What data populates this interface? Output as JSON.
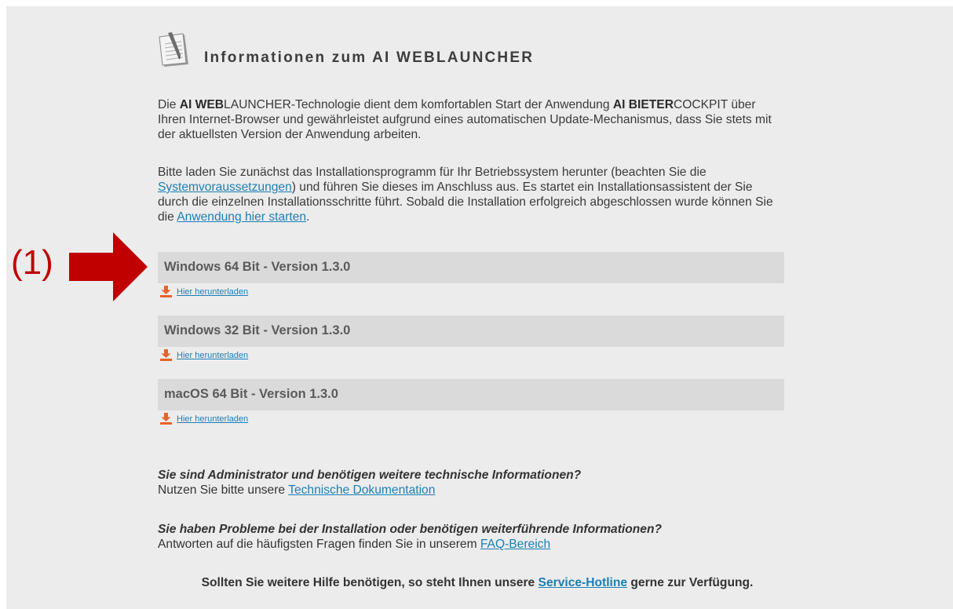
{
  "header": {
    "title": "Informationen zum AI WEBLAUNCHER",
    "icon": "notepad-icon"
  },
  "intro": {
    "p1_b1": "AI WEB",
    "p1_t1": "Die ",
    "p1_t2": "LAUNCHER-Technologie dient dem komfortablen Start der Anwendung ",
    "p1_b2": "AI BIETER",
    "p1_t3": "COCKPIT über Ihren Internet-Browser und gewährleistet aufgrund eines automatischen Update-Mechanismus, dass Sie stets mit der aktuellsten Version der Anwendung arbeiten.",
    "p2_t1": "Bitte laden Sie zunächst das Installationsprogramm für Ihr Betriebssystem herunter (beachten Sie die ",
    "p2_link1": "Systemvoraussetzungen",
    "p2_t2": ") und führen Sie dieses im Anschluss aus. Es startet ein Installationsassistent der Sie durch die einzelnen Installationsschritte führt. Sobald die Installation erfolgreich abgeschlossen wurde können Sie die ",
    "p2_link2": "Anwendung hier starten",
    "p2_t3": "."
  },
  "downloads": [
    {
      "title": "Windows 64 Bit - Version 1.3.0",
      "link": "Hier herunterladen"
    },
    {
      "title": "Windows 32 Bit - Version 1.3.0",
      "link": "Hier herunterladen"
    },
    {
      "title": "macOS 64 Bit - Version 1.3.0",
      "link": "Hier herunterladen"
    }
  ],
  "admin": {
    "question": "Sie sind Administrator und benötigen weitere technische Informationen?",
    "text": "Nutzen Sie bitte unsere ",
    "link": "Technische Dokumentation"
  },
  "faq": {
    "question": "Sie haben Probleme bei der Installation oder benötigen weiterführende Informationen?",
    "text": "Antworten auf die häufigsten Fragen finden Sie in unserem ",
    "link": "FAQ-Bereich"
  },
  "footer": {
    "t1": "Sollten Sie weitere Hilfe benötigen, so steht Ihnen unsere ",
    "link": "Service-Hotline",
    "t2": " gerne zur Verfügung."
  },
  "annotation": {
    "label": "(1)",
    "color": "#c00000"
  },
  "colors": {
    "background": "#ececec",
    "bar": "#dadada",
    "link": "#1c7fb4",
    "download_icon": "#e8622a"
  }
}
